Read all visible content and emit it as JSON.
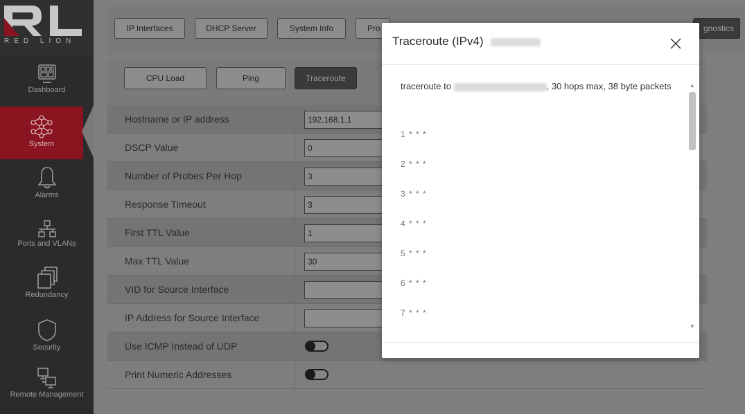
{
  "sidebar": {
    "brand": "RED LION",
    "items": [
      {
        "label": "Dashboard",
        "icon": "dashboard-icon"
      },
      {
        "label": "System",
        "icon": "system-network-icon"
      },
      {
        "label": "Alarms",
        "icon": "bell-icon"
      },
      {
        "label": "Ports and VLANs",
        "icon": "ports-icon"
      },
      {
        "label": "Redundancy",
        "icon": "redundancy-icon"
      },
      {
        "label": "Security",
        "icon": "shield-icon"
      },
      {
        "label": "Remote Management",
        "icon": "remote-management-icon"
      }
    ]
  },
  "tabs": {
    "ip_interfaces": "IP Interfaces",
    "dhcp_server": "DHCP Server",
    "system_info": "System Info",
    "pro_partial": "Pro",
    "diagnostics_partial": "gnostics"
  },
  "subtabs": {
    "cpu_load": "CPU Load",
    "ping": "Ping",
    "traceroute": "Traceroute"
  },
  "form": {
    "rows": [
      {
        "label": "Hostname or IP address",
        "value": "192.168.1.1"
      },
      {
        "label": "DSCP Value",
        "value": "0"
      },
      {
        "label": "Number of Probes Per Hop",
        "value": "3"
      },
      {
        "label": "Response Timeout",
        "value": "3"
      },
      {
        "label": "First TTL Value",
        "value": "1"
      },
      {
        "label": "Max TTL Value",
        "value": "30"
      },
      {
        "label": "VID for Source Interface",
        "value": ""
      },
      {
        "label": "IP Address for Source Interface",
        "value": ""
      },
      {
        "label": "Use ICMP Instead of UDP",
        "toggle": false
      },
      {
        "label": "Print Numeric Addresses",
        "toggle": false
      }
    ]
  },
  "modal": {
    "title": "Traceroute (IPv4)",
    "text_prefix": "traceroute to",
    "text_suffix": ", 30 hops max, 38 byte packets",
    "hops": [
      "1 * * *",
      "2 * * *",
      "3 * * *",
      "4 * * *",
      "5 * * *",
      "6 * * *",
      "7 * * *"
    ]
  }
}
